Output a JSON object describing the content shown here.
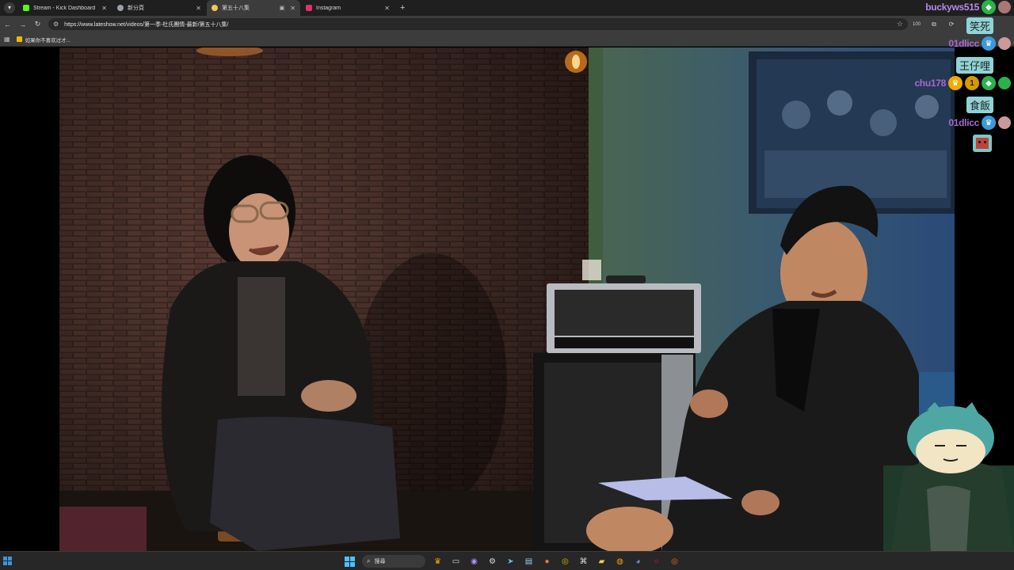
{
  "browser": {
    "tabs": [
      {
        "title": "Stream - Kick Dashboard",
        "favicon_color": "#53fc18",
        "active": false
      },
      {
        "title": "新分頁",
        "favicon_color": "#9aa0a6",
        "active": false
      },
      {
        "title": "第五十八集",
        "favicon_color": "#f2c94c",
        "active": true
      },
      {
        "title": "Instagram",
        "favicon_color": "#e1306c",
        "active": false
      }
    ],
    "new_tab_symbol": "+",
    "url": "https://www.lateshow.net/videos/第一季-杜氏團情-最新/第五十八集/",
    "zoom_badge": "100",
    "bookmark_label": "如果你不喜欢过才..."
  },
  "chat": {
    "messages": [
      {
        "user": "buckyws515",
        "user_color": "#b28ce8",
        "text": "笑死"
      },
      {
        "user": "01dlicc",
        "user_color": "#a56ad1",
        "text": "王仔哩"
      },
      {
        "user": "chu178",
        "user_color": "#a56ad1",
        "text": "食飯"
      },
      {
        "user": "01dlicc",
        "user_color": "#a56ad1",
        "text": "",
        "emote": "emote"
      }
    ],
    "bubble_color": "#8fd3d6"
  },
  "taskbar": {
    "search_text": "搜尋",
    "icons": [
      "widgets-icon",
      "file-explorer-icon",
      "copilot-icon",
      "settings-icon",
      "steam-icon",
      "store-icon",
      "firefox-icon",
      "chrome-icon",
      "capcut-icon",
      "folder-icon",
      "bittorrent-icon",
      "discord-icon",
      "opera-icon",
      "chrome-canary-icon"
    ]
  }
}
